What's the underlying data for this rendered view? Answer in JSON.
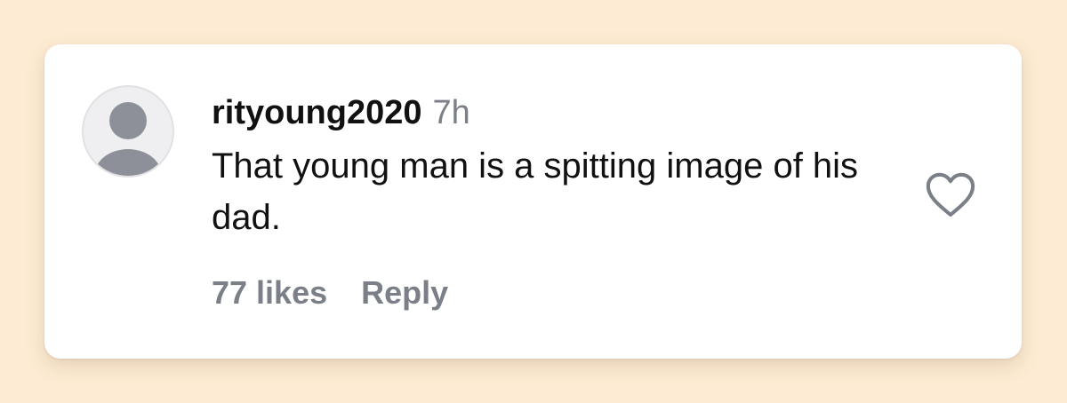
{
  "comment": {
    "username": "rityoung2020",
    "time": "7h",
    "text": "That young man is a spitting image of his dad.",
    "likes_label": "77 likes",
    "reply_label": "Reply"
  },
  "icons": {
    "avatar": "default-user-avatar",
    "like": "heart-outline-icon"
  },
  "colors": {
    "page_background": "#fdebd3",
    "card_background": "#ffffff",
    "secondary_text": "#7b7f88",
    "avatar_figure": "#8e9099"
  }
}
